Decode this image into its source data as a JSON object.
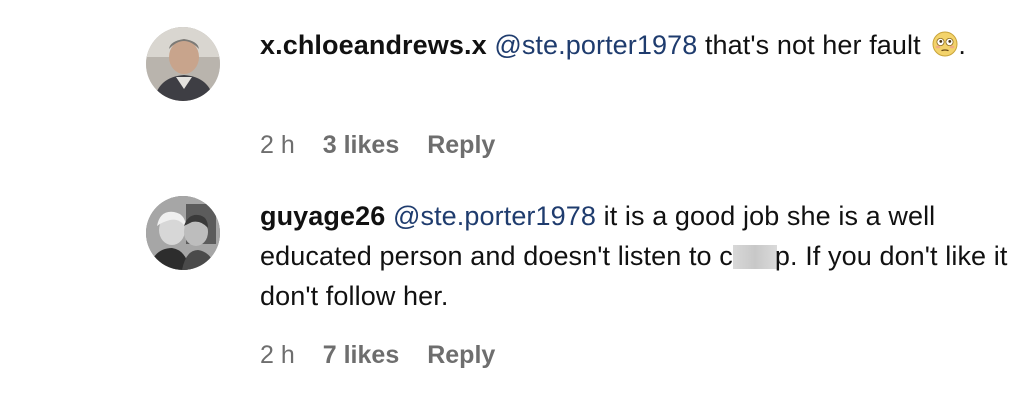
{
  "comments": [
    {
      "username": "x.chloeandrews.x",
      "mention": "@ste.porter1978",
      "text_before": " that's not her fault",
      "emoji": "flushed-face-emoji",
      "text_after": ".",
      "time": "2 h",
      "likes": "3 likes",
      "reply_label": "Reply"
    },
    {
      "username": "guyage26",
      "mention": "@ste.porter1978",
      "text_before": " it is a good job she is a well educated person and doesn't listen to c",
      "censored": "censored-word-blur",
      "text_after": "p. If you don't like it don't follow her.",
      "time": "2 h",
      "likes": "7 likes",
      "reply_label": "Reply"
    }
  ]
}
